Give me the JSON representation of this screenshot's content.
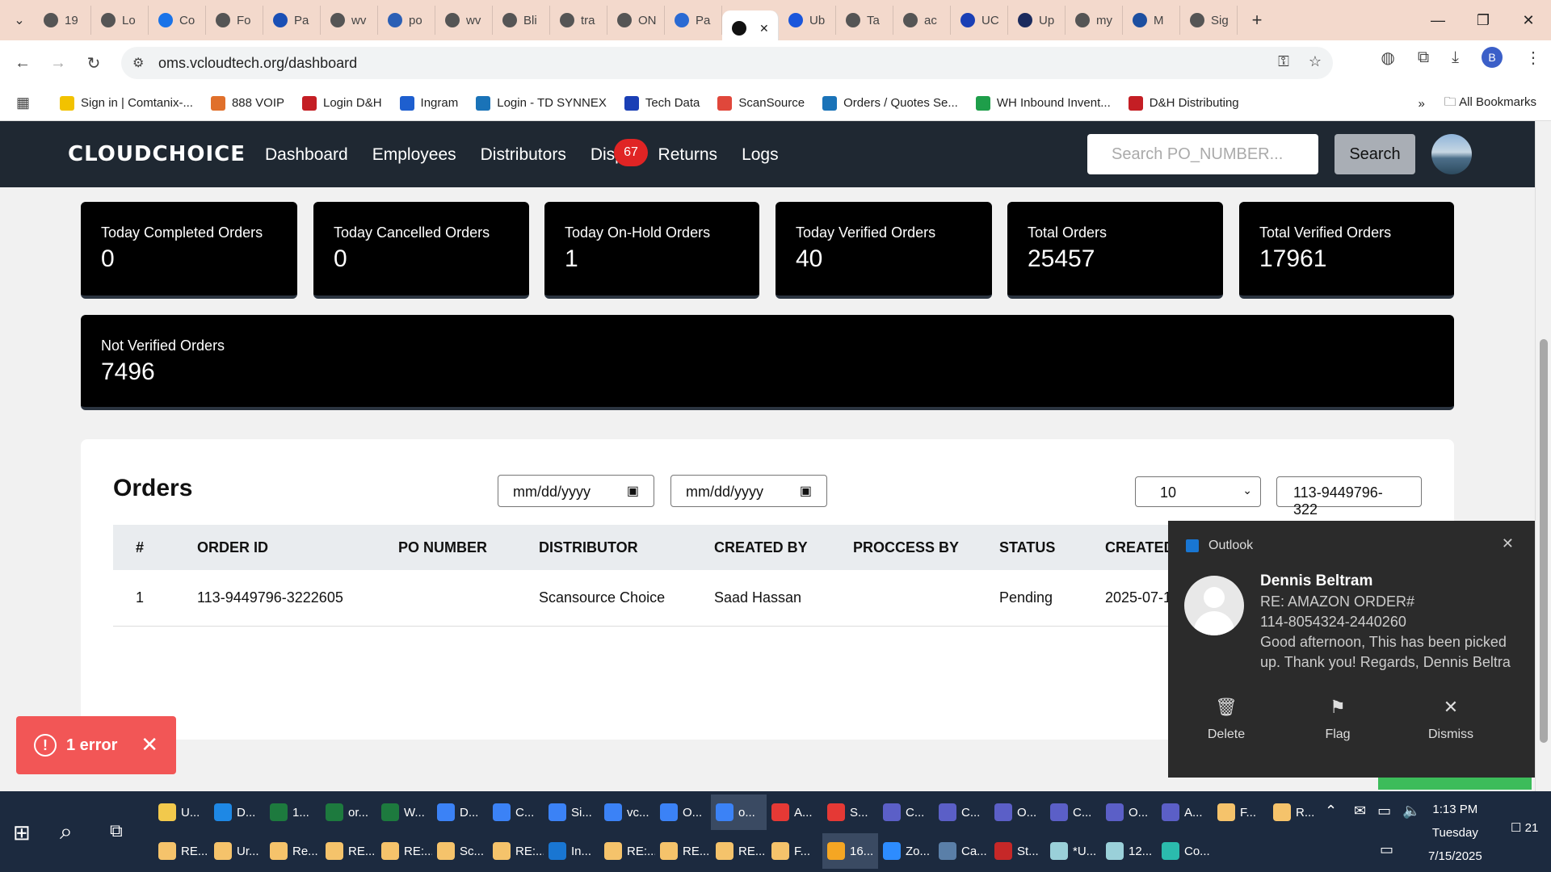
{
  "browser": {
    "tabs": [
      {
        "label": "19",
        "icon": "globe-icon",
        "color": "#555555"
      },
      {
        "label": "Lo",
        "icon": "globe-icon",
        "color": "#555555"
      },
      {
        "label": "Co",
        "icon": "logo-icon",
        "color": "#1a73e8"
      },
      {
        "label": "Fo",
        "icon": "globe-icon",
        "color": "#555555"
      },
      {
        "label": "Pa",
        "icon": "chevron-icon",
        "color": "#1a4fb5"
      },
      {
        "label": "wv",
        "icon": "globe-icon",
        "color": "#555555"
      },
      {
        "label": "po",
        "icon": "arrow-icon",
        "color": "#2b5fb5"
      },
      {
        "label": "wv",
        "icon": "globe-icon",
        "color": "#555555"
      },
      {
        "label": "Bli",
        "icon": "globe-icon",
        "color": "#555555"
      },
      {
        "label": "tra",
        "icon": "globe-icon",
        "color": "#555555"
      },
      {
        "label": "ON",
        "icon": "globe-icon",
        "color": "#555555"
      },
      {
        "label": "Pa",
        "icon": "cloud-icon",
        "color": "#2a6ad3"
      },
      {
        "label": "",
        "icon": "app-icon",
        "color": "#111111",
        "active": true
      },
      {
        "label": "Ub",
        "icon": "u-icon",
        "color": "#1a56db"
      },
      {
        "label": "Ta",
        "icon": "globe-icon",
        "color": "#555555"
      },
      {
        "label": "ac",
        "icon": "globe-icon",
        "color": "#555555"
      },
      {
        "label": "UC",
        "icon": "logo-icon",
        "color": "#1a3fb5"
      },
      {
        "label": "Up",
        "icon": "check-icon",
        "color": "#1b2b5e"
      },
      {
        "label": "my",
        "icon": "globe-icon",
        "color": "#555555"
      },
      {
        "label": "M",
        "icon": "etn-icon",
        "color": "#1d4fa0"
      },
      {
        "label": "Sig",
        "icon": "globe-icon",
        "color": "#555555"
      }
    ],
    "url": "oms.vcloudtech.org/dashboard",
    "profile_initial": "B",
    "bookmarks": [
      {
        "label": "Sign in | Comtanix-...",
        "color": "#f2c200"
      },
      {
        "label": "888 VOIP",
        "color": "#e0702b"
      },
      {
        "label": "Login D&H",
        "color": "#c41e24"
      },
      {
        "label": "Ingram",
        "color": "#1e5fcf"
      },
      {
        "label": "Login - TD SYNNEX",
        "color": "#1a73b8"
      },
      {
        "label": "Tech Data",
        "color": "#1a3fb5"
      },
      {
        "label": "ScanSource",
        "color": "#e0473b"
      },
      {
        "label": "Orders / Quotes Se...",
        "color": "#1a73b8"
      },
      {
        "label": "WH Inbound Invent...",
        "color": "#1e9e4a"
      },
      {
        "label": "D&H Distributing",
        "color": "#c41e24"
      }
    ],
    "more_label": "»",
    "all_bookmarks": "All Bookmarks"
  },
  "app": {
    "logo": "CLOUDCHOICE",
    "nav": [
      "Dashboard",
      "Employees",
      "Distributors",
      "Dispu",
      "Returns",
      "Logs"
    ],
    "dispute_badge": "67",
    "search_placeholder": "Search PO_NUMBER...",
    "search_button": "Search"
  },
  "stats": [
    {
      "label": "Today Completed Orders",
      "value": "0"
    },
    {
      "label": "Today Cancelled Orders",
      "value": "0"
    },
    {
      "label": "Today On-Hold Orders",
      "value": "1"
    },
    {
      "label": "Today Verified Orders",
      "value": "40"
    },
    {
      "label": "Total Orders",
      "value": "25457"
    },
    {
      "label": "Total Verified Orders",
      "value": "17961"
    },
    {
      "label": "Not Verified Orders",
      "value": "7496"
    }
  ],
  "orders": {
    "title": "Orders",
    "date_from": "mm/dd/yyyy",
    "date_to": "mm/dd/yyyy",
    "page_size": "10",
    "filter_value": "113-9449796-322",
    "columns": [
      "#",
      "ORDER ID",
      "PO NUMBER",
      "DISTRIBUTOR",
      "CREATED BY",
      "PROCCESS BY",
      "STATUS",
      "CREATED"
    ],
    "rows": [
      {
        "num": "1",
        "order_id": "113-9449796-3222605",
        "po_number": "",
        "distributor": "Scansource Choice",
        "created_by": "Saad Hassan",
        "process_by": "",
        "status": "Pending",
        "created": "2025-07-1"
      }
    ]
  },
  "error_toast": {
    "label": "1 error",
    "color": "#f25656"
  },
  "notification": {
    "app": "Outlook",
    "from": "Dennis Beltram",
    "lines": [
      "RE: AMAZON ORDER#",
      "114-8054324-2440260",
      "Good afternoon,  This has been picked",
      "up.  Thank you!  Regards,  Dennis Beltra"
    ],
    "actions": [
      "Delete",
      "Flag",
      "Dismiss"
    ]
  },
  "taskbar": {
    "row1": [
      {
        "label": "U...",
        "color": "#f2c94c"
      },
      {
        "label": "D...",
        "color": "#1e88e5"
      },
      {
        "label": "1...",
        "color": "#1d7a3e"
      },
      {
        "label": "or...",
        "color": "#1d7a3e"
      },
      {
        "label": "W...",
        "color": "#1d7a3e"
      },
      {
        "label": "D...",
        "color": "#3b82f6"
      },
      {
        "label": "C...",
        "color": "#3b82f6"
      },
      {
        "label": "Si...",
        "color": "#3b82f6"
      },
      {
        "label": "vc...",
        "color": "#3b82f6"
      },
      {
        "label": "O...",
        "color": "#3b82f6"
      },
      {
        "label": "o...",
        "color": "#3b82f6",
        "active": true
      },
      {
        "label": "A...",
        "color": "#e53935"
      },
      {
        "label": "S...",
        "color": "#e53935"
      },
      {
        "label": "C...",
        "color": "#5b5fc7"
      },
      {
        "label": "C...",
        "color": "#5b5fc7"
      },
      {
        "label": "O...",
        "color": "#5b5fc7"
      },
      {
        "label": "C...",
        "color": "#5b5fc7"
      },
      {
        "label": "O...",
        "color": "#5b5fc7"
      },
      {
        "label": "A...",
        "color": "#5b5fc7"
      },
      {
        "label": "F...",
        "color": "#f5c36b"
      },
      {
        "label": "R...",
        "color": "#f5c36b"
      }
    ],
    "row2": [
      {
        "label": "RE...",
        "color": "#f5c36b"
      },
      {
        "label": "Ur...",
        "color": "#f5c36b"
      },
      {
        "label": "Re...",
        "color": "#f5c36b"
      },
      {
        "label": "RE...",
        "color": "#f5c36b"
      },
      {
        "label": "RE:...",
        "color": "#f5c36b"
      },
      {
        "label": "Sc...",
        "color": "#f5c36b"
      },
      {
        "label": "RE:...",
        "color": "#f5c36b"
      },
      {
        "label": "In...",
        "color": "#1976d2"
      },
      {
        "label": "RE:...",
        "color": "#f5c36b"
      },
      {
        "label": "RE...",
        "color": "#f5c36b"
      },
      {
        "label": "RE...",
        "color": "#f5c36b"
      },
      {
        "label": "F...",
        "color": "#f5c36b"
      },
      {
        "label": "16...",
        "color": "#f5a623",
        "active": true
      },
      {
        "label": "Zo...",
        "color": "#2d8cff"
      },
      {
        "label": "Ca...",
        "color": "#5a7fa8"
      },
      {
        "label": "St...",
        "color": "#c62828"
      },
      {
        "label": "*U...",
        "color": "#9ad0d9"
      },
      {
        "label": "12...",
        "color": "#9ad0d9"
      },
      {
        "label": "Co...",
        "color": "#2bbbad"
      }
    ],
    "time": "1:13 PM",
    "day": "Tuesday",
    "date": "7/15/2025",
    "notif_count": "21"
  }
}
